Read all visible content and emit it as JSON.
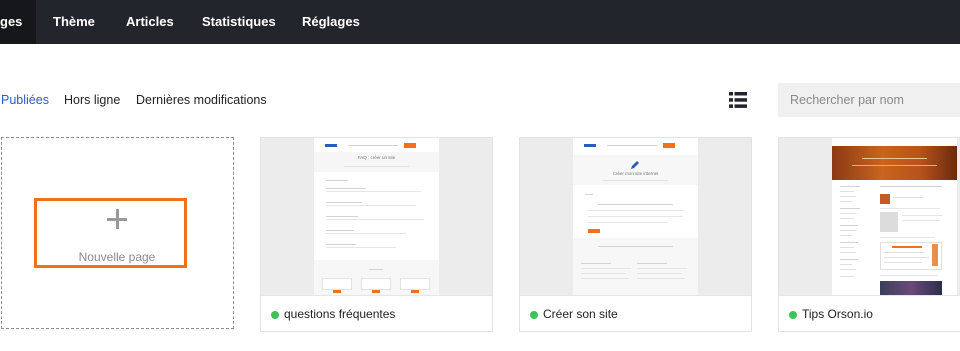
{
  "nav": {
    "items": [
      {
        "label": "ges",
        "active": true
      },
      {
        "label": "Thème",
        "active": false
      },
      {
        "label": "Articles",
        "active": false
      },
      {
        "label": "Statistiques",
        "active": false
      },
      {
        "label": "Réglages",
        "active": false
      }
    ]
  },
  "filters": {
    "items": [
      {
        "label": "Publiées",
        "active": true
      },
      {
        "label": "Hors ligne",
        "active": false
      },
      {
        "label": "Dernières modifications",
        "active": false
      }
    ]
  },
  "view_icon": "list-icon",
  "search": {
    "placeholder": "Rechercher par nom",
    "value": ""
  },
  "new_page": {
    "label": "Nouvelle page",
    "icon": "plus-icon"
  },
  "pages": [
    {
      "title": "questions fréquentes",
      "status": "online",
      "status_color": "#3fc15b",
      "thumb_heading": "FAQ : créer un site"
    },
    {
      "title": "Créer son site",
      "status": "online",
      "status_color": "#3fc15b",
      "thumb_heading": "Créer mon site internet"
    },
    {
      "title": "Tips Orson.io",
      "status": "online",
      "status_color": "#3fc15b",
      "thumb_heading": ""
    }
  ],
  "colors": {
    "accent": "#f0701c",
    "active_link": "#2c5bbd",
    "nav_bg": "#23252c"
  }
}
